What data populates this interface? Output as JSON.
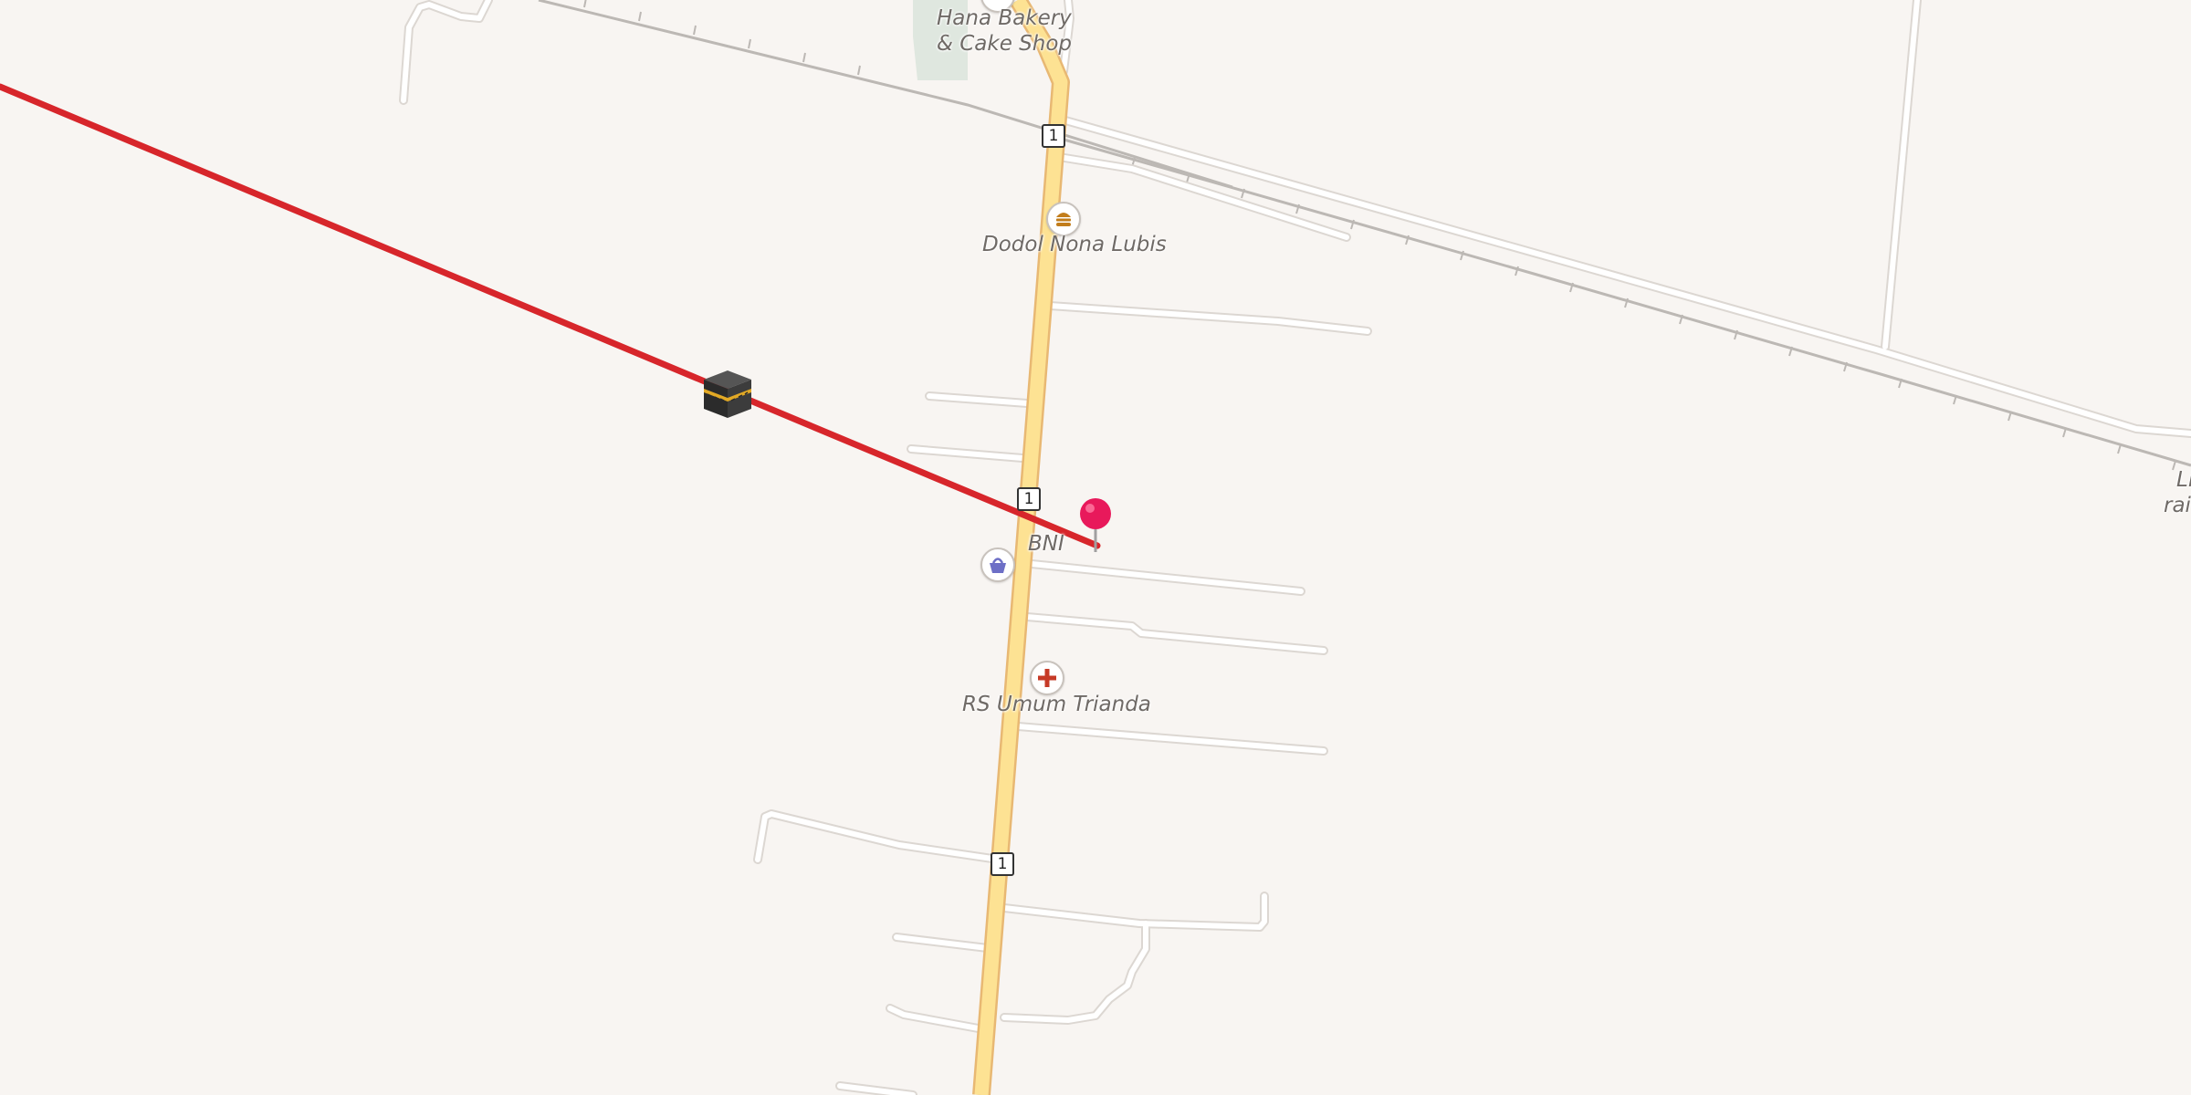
{
  "map": {
    "background_color": "#f8f5f2",
    "road_color": "#ffffff",
    "road_casing_color": "#dcd7d2",
    "primary_road_color": "#fde293",
    "primary_road_casing_color": "#e8b873",
    "route_color": "#d7262b",
    "railway_color": "#bcb8b4",
    "landuse_color": "#dfe7df"
  },
  "road_shields": [
    {
      "ref": "1"
    },
    {
      "ref": "1"
    },
    {
      "ref": "1"
    }
  ],
  "pois": [
    {
      "name": "Hana Bakery\n& Cake Shop",
      "line1": "Hana Bakery",
      "line2": "& Cake Shop"
    },
    {
      "name": "Dodol Nona Lubis",
      "icon": "burger-icon",
      "icon_color": "#c27d1b"
    },
    {
      "name": "BNI",
      "icon": "shopping-basket-icon",
      "icon_color": "#6d6fc6"
    },
    {
      "name": "RS Umum Trianda",
      "icon": "hospital-cross-icon",
      "icon_color": "#c63a27"
    }
  ],
  "edge_label": {
    "line1": "Li",
    "line2": "rai"
  },
  "markers": {
    "destination_pin": {
      "icon": "map-pin-icon",
      "color": "#e8195b"
    },
    "origin_icon": {
      "icon": "kaaba-icon",
      "color": "#2b2b2b",
      "band_color": "#e2a925"
    }
  }
}
